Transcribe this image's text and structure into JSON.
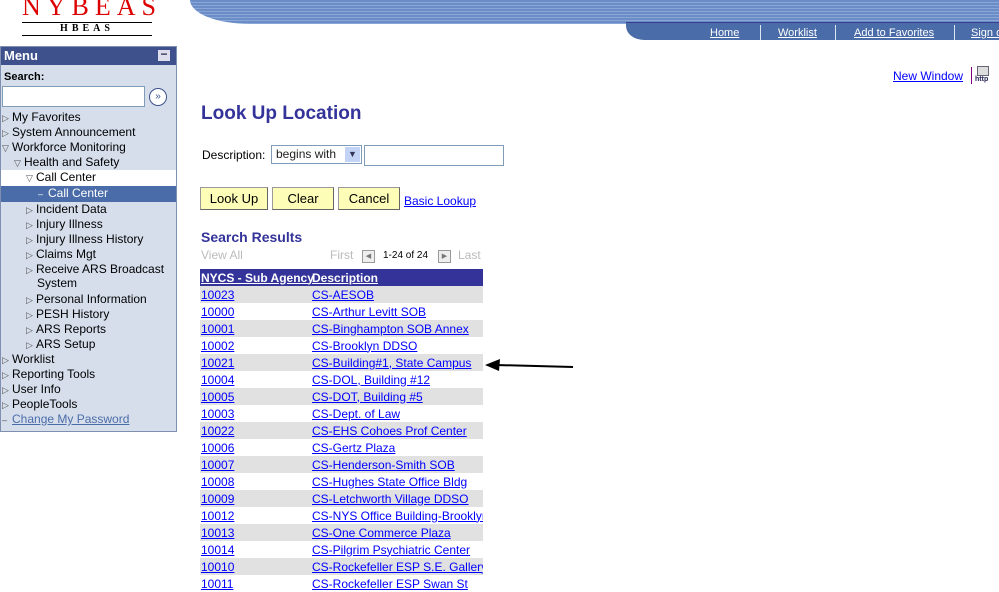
{
  "logo": {
    "main": "NYBEAS",
    "sub": "HBEAS"
  },
  "topnav": [
    "Home",
    "Worklist",
    "Add to Favorites",
    "Sign out"
  ],
  "new_window": "New Window",
  "http_icon_label": "http",
  "menu": {
    "title": "Menu",
    "search_label": "Search:",
    "search_value": "",
    "items": [
      {
        "label": "My Favorites",
        "level": 0,
        "state": "collapsed"
      },
      {
        "label": "System Announcement",
        "level": 0,
        "state": "collapsed"
      },
      {
        "label": "Workforce Monitoring",
        "level": 0,
        "state": "expanded"
      },
      {
        "label": "Health and Safety",
        "level": 1,
        "state": "expanded"
      },
      {
        "label": "Call Center",
        "level": 2,
        "state": "expanded"
      },
      {
        "label": "Call Center",
        "level": 3,
        "state": "current"
      },
      {
        "label": "Incident Data",
        "level": 2,
        "state": "collapsed"
      },
      {
        "label": "Injury Illness",
        "level": 2,
        "state": "collapsed"
      },
      {
        "label": "Injury Illness History",
        "level": 2,
        "state": "collapsed"
      },
      {
        "label": "Claims Mgt",
        "level": 2,
        "state": "collapsed"
      },
      {
        "label": "Receive ARS Broadcast",
        "label2": "System",
        "level": 2,
        "state": "collapsed"
      },
      {
        "label": "Personal Information",
        "level": 2,
        "state": "collapsed"
      },
      {
        "label": "PESH History",
        "level": 2,
        "state": "collapsed"
      },
      {
        "label": "ARS Reports",
        "level": 2,
        "state": "collapsed"
      },
      {
        "label": "ARS Setup",
        "level": 2,
        "state": "collapsed"
      },
      {
        "label": "Worklist",
        "level": 0,
        "state": "collapsed"
      },
      {
        "label": "Reporting Tools",
        "level": 0,
        "state": "collapsed"
      },
      {
        "label": "User Info",
        "level": 0,
        "state": "collapsed"
      },
      {
        "label": "PeopleTools",
        "level": 0,
        "state": "collapsed"
      },
      {
        "label": "Change My Password",
        "level": 0,
        "state": "link"
      }
    ]
  },
  "page": {
    "title": "Look Up Location",
    "desc_label": "Description:",
    "operator": "begins with",
    "desc_value": "",
    "buttons": {
      "lookup": "Look Up",
      "clear": "Clear",
      "cancel": "Cancel"
    },
    "basic_lookup": "Basic Lookup",
    "results_title": "Search Results",
    "view_all": "View All",
    "first": "First",
    "last": "Last",
    "count": "1-24 of 24",
    "columns": [
      "NYCS - Sub Agency",
      "Description"
    ],
    "rows": [
      [
        "10023",
        "CS-AESOB"
      ],
      [
        "10000",
        "CS-Arthur Levitt SOB"
      ],
      [
        "10001",
        "CS-Binghampton SOB Annex"
      ],
      [
        "10002",
        "CS-Brooklyn DDSO"
      ],
      [
        "10021",
        "CS-Building#1, State Campus"
      ],
      [
        "10004",
        "CS-DOL, Building #12"
      ],
      [
        "10005",
        "CS-DOT, Building #5"
      ],
      [
        "10003",
        "CS-Dept. of Law"
      ],
      [
        "10022",
        "CS-EHS Cohoes Prof Center"
      ],
      [
        "10006",
        "CS-Gertz Plaza"
      ],
      [
        "10007",
        "CS-Henderson-Smith SOB"
      ],
      [
        "10008",
        "CS-Hughes State Office Bldg"
      ],
      [
        "10009",
        "CS-Letchworth Village DDSO"
      ],
      [
        "10012",
        "CS-NYS Office Building-Brooklyn"
      ],
      [
        "10013",
        "CS-One Commerce Plaza"
      ],
      [
        "10014",
        "CS-Pilgrim Psychiatric Center"
      ],
      [
        "10010",
        "CS-Rockefeller ESP S.E. Gallery"
      ],
      [
        "10011",
        "CS-Rockefeller ESP Swan St"
      ]
    ]
  }
}
